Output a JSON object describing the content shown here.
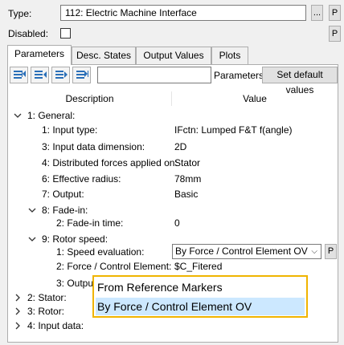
{
  "header": {
    "type_label": "Type:",
    "type_value": "112: Electric Machine Interface",
    "browse_label": "...",
    "p_label": "P",
    "disabled_label": "Disabled:"
  },
  "tabs": [
    {
      "label": "Parameters",
      "active": true
    },
    {
      "label": "Desc. States",
      "active": false
    },
    {
      "label": "Output Values",
      "active": false
    },
    {
      "label": "Plots",
      "active": false
    }
  ],
  "toolbar": {
    "search_value": "",
    "parameters_label": "Parameters:",
    "set_default_label": "Set default values"
  },
  "columns": {
    "description": "Description",
    "value": "Value"
  },
  "tree": {
    "general": "1: General:",
    "input_type": {
      "label": "1: Input type:",
      "value": "IFctn: Lumped F&T f(angle)"
    },
    "input_dim": {
      "label": "3: Input data dimension:",
      "value": "2D"
    },
    "dist_forces": {
      "label": "4: Distributed forces applied on:",
      "value": "Stator"
    },
    "eff_radius": {
      "label": "6: Effective radius:",
      "value": "78mm"
    },
    "output": {
      "label": "7: Output:",
      "value": "Basic"
    },
    "fade_in": "8: Fade-in:",
    "fade_in_time": {
      "label": "2: Fade-in time:",
      "value": "0"
    },
    "rotor_speed": "9: Rotor speed:",
    "speed_eval": {
      "label": "1: Speed evaluation:",
      "value": "By Force / Control Element OV"
    },
    "force_elem": {
      "label": "2: Force / Control Element:",
      "value": "$C_Fitered"
    },
    "output_trunc": "3: Outpu",
    "stator": "2: Stator:",
    "rotor": "3: Rotor:",
    "input_data": "4: Input data:"
  },
  "popup": {
    "options": [
      {
        "label": "From Reference Markers",
        "selected": false
      },
      {
        "label": "By Force / Control Element OV",
        "selected": true
      }
    ]
  },
  "colors": {
    "highlight_border": "#f0b400",
    "selected_bg": "#cce8ff"
  }
}
